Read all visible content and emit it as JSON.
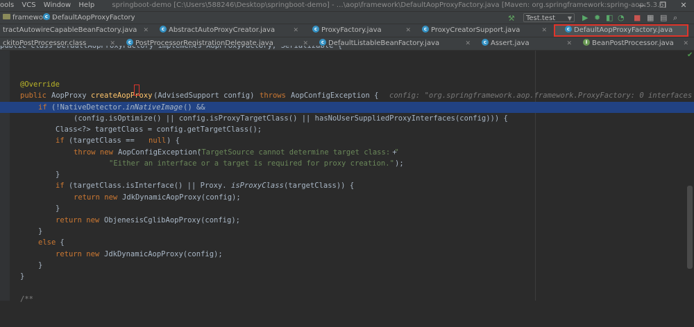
{
  "menubar": {
    "items": [
      "ools",
      "VCS",
      "Window",
      "Help"
    ],
    "title": "springboot-demo [C:\\Users\\588246\\Desktop\\springboot-demo] - …\\aop\\framework\\DefaultAopProxyFactory.java [Maven: org.springframework:spring-aop:5.3.6]"
  },
  "navbar": {
    "crumb_folder": "framework",
    "crumb_file": "DefaultAopProxyFactory",
    "run_config": "Test.test"
  },
  "tabs_row1": [
    {
      "label": "tractAutowireCapableBeanFactory.java"
    },
    {
      "label": "AbstractAutoProxyCreator.java"
    },
    {
      "label": "ProxyFactory.java"
    },
    {
      "label": "ProxyCreatorSupport.java"
    },
    {
      "label": "DefaultAopProxyFactory.java",
      "active": true
    }
  ],
  "tabs_row2": [
    {
      "label": "ckitoPostProcessor.class"
    },
    {
      "label": "PostProcessorRegistrationDelegate.java"
    },
    {
      "label": "DefaultListableBeanFactory.java"
    },
    {
      "label": "Assert.java"
    },
    {
      "label": "BeanPostProcessor.java"
    }
  ],
  "code": {
    "header_partial": "public class DefaultAopProxyFactory implements AopProxyFactory, Serializable {",
    "annotation": "@Override",
    "sig_public": "public",
    "sig_type": "AopProxy",
    "sig_method": "createAopProxy",
    "sig_params": "(AdvisedSupport config)",
    "sig_throws": "throws",
    "sig_exc": "AopConfigException {",
    "sig_hint": "config: \"org.springframework.aop.framework.ProxyFactory: 0 interfaces",
    "if1_kw": "if",
    "if1_a": "(!NativeDetector.",
    "if1_m": "inNativeImage",
    "if1_b": "() &&",
    "cond2": "(config.isOptimize() || config.isProxyTargetClass() || hasNoUserSuppliedProxyInterfaces(config))) {",
    "decl": "Class<?> targetClass = config.getTargetClass();",
    "if2_kw": "if",
    "if2_a": "(targetClass == ",
    "if2_null": "null",
    "if2_b": ") {",
    "throw_kw": "throw new",
    "throw_a": "AopConfigException(",
    "throw_str1": "\"TargetSource cannot determine target class: \"",
    "throw_plus": " +",
    "throw_str2": "\"Either an interface or a target is required for proxy creation.\"",
    "throw_end": ");",
    "brace_close": "}",
    "if3_kw": "if",
    "if3_a": "(targetClass.isInterface() || Proxy.",
    "if3_m": "isProxyClass",
    "if3_b": "(targetClass)) {",
    "ret1_kw": "return new",
    "ret1": "JdkDynamicAopProxy(config);",
    "ret2_kw": "return new",
    "ret2": "ObjenesisCglibAopProxy(config);",
    "else_kw": "else",
    "else_brace": " {",
    "ret3_kw": "return new",
    "ret3": "JdkDynamicAopProxy(config);",
    "comment": "/**"
  }
}
